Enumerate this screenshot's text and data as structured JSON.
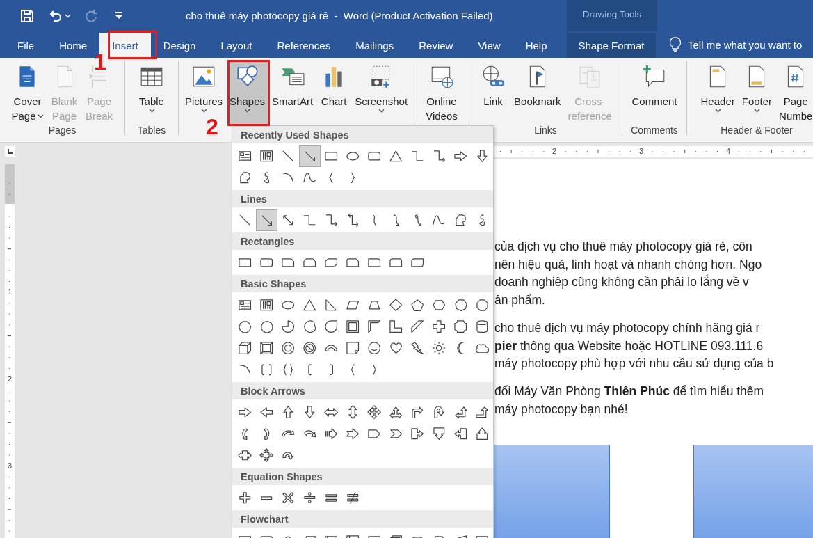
{
  "title_bar": {
    "title": "cho thuê máy photocopy giá rẻ  -  Word (Product Activation Failed)",
    "context_header": "Drawing Tools",
    "quick_access": [
      {
        "disabled": false
      },
      {
        "disabled": false
      },
      {
        "disabled": true
      },
      {
        "disabled": false
      }
    ]
  },
  "tabs": [
    {
      "label": "File",
      "selected": false,
      "kind": "regular"
    },
    {
      "label": "Home",
      "selected": false,
      "kind": "regular"
    },
    {
      "label": "Insert",
      "selected": true,
      "kind": "regular"
    },
    {
      "label": "Design",
      "selected": false,
      "kind": "regular"
    },
    {
      "label": "Layout",
      "selected": false,
      "kind": "regular"
    },
    {
      "label": "References",
      "selected": false,
      "kind": "regular"
    },
    {
      "label": "Mailings",
      "selected": false,
      "kind": "regular"
    },
    {
      "label": "Review",
      "selected": false,
      "kind": "regular"
    },
    {
      "label": "View",
      "selected": false,
      "kind": "regular"
    },
    {
      "label": "Help",
      "selected": false,
      "kind": "regular"
    },
    {
      "label": "Shape Format",
      "selected": false,
      "kind": "contextual"
    }
  ],
  "tell_me": {
    "placeholder": "Tell me what you want to"
  },
  "ribbon": {
    "groups": [
      {
        "label": "Pages",
        "buttons": [
          {
            "lines": [
              "Cover",
              "Page"
            ],
            "dropdown": true,
            "disabled": false,
            "pressed": false
          },
          {
            "lines": [
              "Blank",
              "Page"
            ],
            "dropdown": false,
            "disabled": true,
            "pressed": false
          },
          {
            "lines": [
              "Page",
              "Break"
            ],
            "dropdown": false,
            "disabled": true,
            "pressed": false
          }
        ]
      },
      {
        "label": "Tables",
        "buttons": [
          {
            "lines": [
              "Table"
            ],
            "dropdown": true,
            "disabled": false,
            "pressed": false
          }
        ]
      },
      {
        "buttons": [
          {
            "lines": [
              "Pictures"
            ],
            "dropdown": true,
            "disabled": false,
            "pressed": false
          },
          {
            "lines": [
              "Shapes"
            ],
            "dropdown": true,
            "disabled": false,
            "pressed": true
          },
          {
            "lines": [
              "SmartArt"
            ],
            "dropdown": false,
            "disabled": false,
            "pressed": false
          },
          {
            "lines": [
              "Chart"
            ],
            "dropdown": false,
            "disabled": false,
            "pressed": false
          },
          {
            "lines": [
              "Screenshot"
            ],
            "dropdown": true,
            "disabled": false,
            "pressed": false
          }
        ]
      },
      {
        "buttons": [
          {
            "lines": [
              "Online",
              "Videos"
            ],
            "dropdown": false,
            "disabled": false,
            "pressed": false
          }
        ]
      },
      {
        "label": "Links",
        "buttons": [
          {
            "lines": [
              "Link"
            ],
            "dropdown": false,
            "disabled": false,
            "pressed": false
          },
          {
            "lines": [
              "Bookmark"
            ],
            "dropdown": false,
            "disabled": false,
            "pressed": false
          },
          {
            "lines": [
              "Cross-",
              "reference"
            ],
            "dropdown": false,
            "disabled": true,
            "pressed": false
          }
        ]
      },
      {
        "label": "Comments",
        "buttons": [
          {
            "lines": [
              "Comment"
            ],
            "dropdown": false,
            "disabled": false,
            "pressed": false
          }
        ]
      },
      {
        "label": "Header & Footer",
        "buttons": [
          {
            "lines": [
              "Header"
            ],
            "dropdown": true,
            "disabled": false,
            "pressed": false
          },
          {
            "lines": [
              "Footer"
            ],
            "dropdown": true,
            "disabled": false,
            "pressed": false
          },
          {
            "lines": [
              "Page",
              "Numbe"
            ],
            "dropdown": false,
            "disabled": false,
            "pressed": false
          }
        ]
      }
    ]
  },
  "shapes_menu": {
    "sections": [
      {
        "title": "Recently Used Shapes",
        "shapes": [
          {
            "selected": false
          },
          {
            "selected": false
          },
          {
            "selected": false
          },
          {
            "selected": true
          },
          {
            "selected": false
          },
          {
            "selected": false
          },
          {
            "selected": false
          },
          {
            "selected": false
          },
          {
            "selected": false
          },
          {
            "selected": false
          },
          {
            "selected": false
          },
          {
            "selected": false
          },
          {
            "selected": false
          },
          {
            "selected": false
          },
          {
            "selected": false
          },
          {
            "selected": false
          },
          {
            "selected": false
          },
          {
            "selected": false
          }
        ]
      },
      {
        "title": "Lines",
        "shapes": [
          {
            "selected": false
          },
          {
            "selected": true
          },
          {
            "selected": false
          },
          {
            "selected": false
          },
          {
            "selected": false
          },
          {
            "selected": false
          },
          {
            "selected": false
          },
          {
            "selected": false
          },
          {
            "selected": false
          },
          {
            "selected": false
          },
          {
            "selected": false
          },
          {
            "selected": false
          }
        ]
      },
      {
        "title": "Rectangles",
        "shapes": [
          {
            "selected": false
          },
          {
            "selected": false
          },
          {
            "selected": false
          },
          {
            "selected": false
          },
          {
            "selected": false
          },
          {
            "selected": false
          },
          {
            "selected": false
          },
          {
            "selected": false
          },
          {
            "selected": false
          }
        ]
      },
      {
        "title": "Basic Shapes",
        "shapes": [
          {
            "selected": false
          },
          {
            "selected": false
          },
          {
            "selected": false
          },
          {
            "selected": false
          },
          {
            "selected": false
          },
          {
            "selected": false
          },
          {
            "selected": false
          },
          {
            "selected": false
          },
          {
            "selected": false
          },
          {
            "selected": false
          },
          {
            "selected": false
          },
          {
            "selected": false
          },
          {
            "selected": false
          },
          {
            "selected": false
          },
          {
            "selected": false
          },
          {
            "selected": false
          },
          {
            "selected": false
          },
          {
            "selected": false
          },
          {
            "selected": false
          },
          {
            "selected": false
          },
          {
            "selected": false
          },
          {
            "selected": false
          },
          {
            "selected": false
          },
          {
            "selected": false
          },
          {
            "selected": false
          },
          {
            "selected": false
          },
          {
            "selected": false
          },
          {
            "selected": false
          },
          {
            "selected": false
          },
          {
            "selected": false
          },
          {
            "selected": false
          },
          {
            "selected": false
          },
          {
            "selected": false
          },
          {
            "selected": false
          },
          {
            "selected": false
          },
          {
            "selected": false
          },
          {
            "selected": false
          },
          {
            "selected": false
          },
          {
            "selected": false
          },
          {
            "selected": false
          },
          {
            "selected": false
          },
          {
            "selected": false
          },
          {
            "selected": false
          }
        ]
      },
      {
        "title": "Block Arrows",
        "shapes": [
          {
            "selected": false
          },
          {
            "selected": false
          },
          {
            "selected": false
          },
          {
            "selected": false
          },
          {
            "selected": false
          },
          {
            "selected": false
          },
          {
            "selected": false
          },
          {
            "selected": false
          },
          {
            "selected": false
          },
          {
            "selected": false
          },
          {
            "selected": false
          },
          {
            "selected": false
          },
          {
            "selected": false
          },
          {
            "selected": false
          },
          {
            "selected": false
          },
          {
            "selected": false
          },
          {
            "selected": false
          },
          {
            "selected": false
          },
          {
            "selected": false
          },
          {
            "selected": false
          },
          {
            "selected": false
          },
          {
            "selected": false
          },
          {
            "selected": false
          },
          {
            "selected": false
          },
          {
            "selected": false
          },
          {
            "selected": false
          },
          {
            "selected": false
          }
        ]
      },
      {
        "title": "Equation Shapes",
        "shapes": [
          {
            "selected": false
          },
          {
            "selected": false
          },
          {
            "selected": false
          },
          {
            "selected": false
          },
          {
            "selected": false
          },
          {
            "selected": false
          }
        ]
      },
      {
        "title": "Flowchart",
        "shapes": [
          {
            "selected": false
          },
          {
            "selected": false
          },
          {
            "selected": false
          },
          {
            "selected": false
          },
          {
            "selected": false
          },
          {
            "selected": false
          },
          {
            "selected": false
          },
          {
            "selected": false
          },
          {
            "selected": false
          },
          {
            "selected": false
          },
          {
            "selected": false
          },
          {
            "selected": false
          }
        ]
      }
    ]
  },
  "rulers": {
    "horizontal": [
      "2",
      "3",
      "4"
    ],
    "vertical": [
      "1",
      "2",
      "3"
    ]
  },
  "document": {
    "paragraphs": [
      {
        "lines": [
          "của dịch vụ cho thuê máy photocopy giá rẻ, côn",
          "nên hiệu quả, linh hoạt và nhanh chóng hơn. Ngo",
          "doanh nghiệp cũng không cần phải lo lắng về v",
          "ản phẩm."
        ]
      },
      {
        "lines": [
          "cho thuê dịch vụ máy photocopy chính hãng giá r",
          "**pier** thông qua Website hoặc HOTLINE 093.111.6",
          "máy photocopy phù hợp với nhu cầu sử dụng của b"
        ]
      },
      {
        "lines": [
          "đối Máy Văn Phòng **Thiên Phúc** để tìm hiểu thêm",
          "máy photocopy bạn nhé!"
        ]
      }
    ]
  },
  "annotations": [
    {
      "label": "1"
    },
    {
      "label": "2"
    }
  ]
}
